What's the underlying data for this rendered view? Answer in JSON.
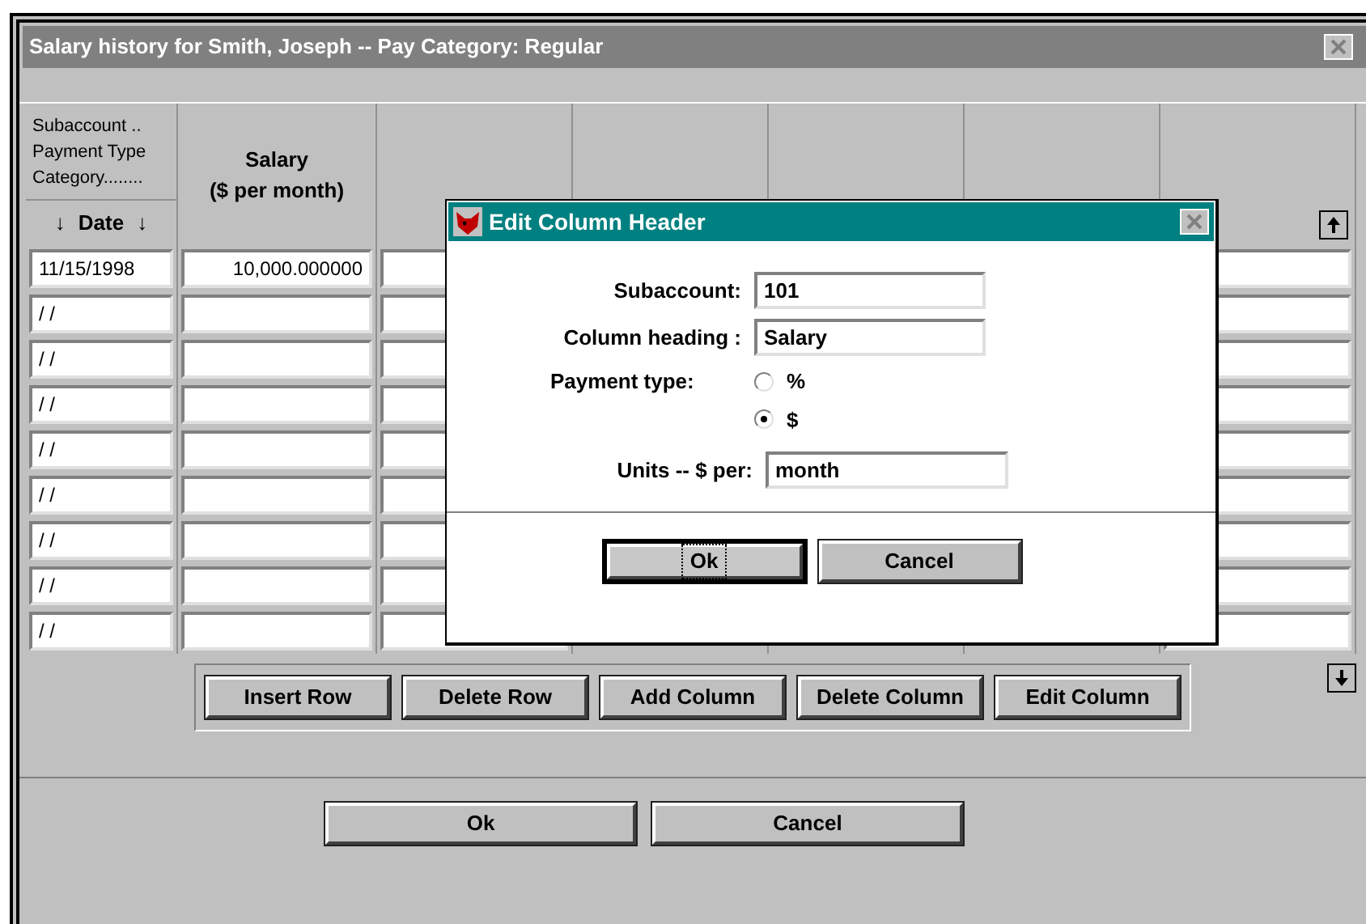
{
  "window": {
    "title": "Salary history for Smith, Joseph -- Pay Category: Regular"
  },
  "table": {
    "row_header_labels": [
      "Subaccount ..",
      "Payment Type",
      "Category........"
    ],
    "date_heading": {
      "arrow_left": "↓",
      "label": "Date",
      "arrow_right": "↓"
    },
    "columns": [
      {
        "heading": "Salary",
        "units": "($ per month)"
      }
    ],
    "rows": [
      {
        "date": "11/15/1998",
        "salary": "10,000.000000"
      },
      {
        "date": "/ /"
      },
      {
        "date": "/ /"
      },
      {
        "date": "/ /"
      },
      {
        "date": "/ /"
      },
      {
        "date": "/ /"
      },
      {
        "date": "/ /"
      },
      {
        "date": "/ /"
      },
      {
        "date": "/ /"
      }
    ]
  },
  "table_buttons": [
    "Insert Row",
    "Delete Row",
    "Add Column",
    "Delete Column",
    "Edit Column"
  ],
  "buttons": [
    "Ok",
    "Cancel"
  ],
  "dialog": {
    "title": "Edit Column Header",
    "fields": [
      {
        "label": "Subaccount:",
        "value": "101"
      },
      {
        "label": "Column heading :",
        "value": "Salary"
      }
    ],
    "payment_type": {
      "label": "Payment type:",
      "options": [
        {
          "label": "%",
          "selected": false
        },
        {
          "label": "$",
          "selected": true
        }
      ]
    },
    "units": {
      "label": "Units -- $ per:",
      "value": "month"
    },
    "buttons": [
      {
        "label": "Ok",
        "focused": true
      },
      {
        "label": "Cancel",
        "focused": false
      }
    ]
  }
}
